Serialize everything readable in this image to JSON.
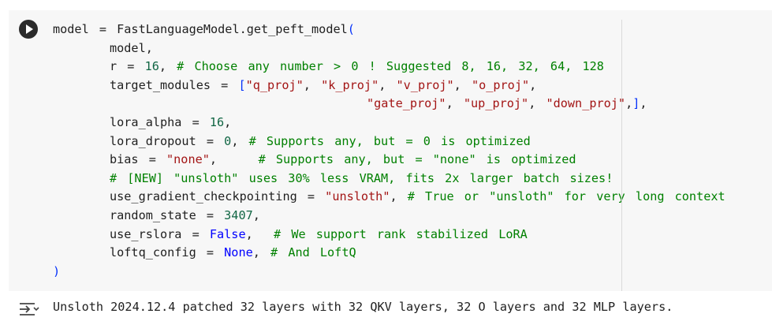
{
  "cell": {
    "lines": [
      {
        "parts": [
          [
            "kw",
            "model = FastLanguageModel.get_peft_model"
          ],
          [
            "brk",
            "("
          ]
        ]
      },
      {
        "indent": 1,
        "parts": [
          [
            "kw",
            "model,"
          ]
        ]
      },
      {
        "indent": 1,
        "parts": [
          [
            "kw",
            "r = "
          ],
          [
            "num",
            "16"
          ],
          [
            "kw",
            ", "
          ],
          [
            "cmt",
            "# Choose any number > 0 ! Suggested 8, 16, 32, 64, 128"
          ]
        ]
      },
      {
        "indent": 1,
        "parts": [
          [
            "kw",
            "target_modules = "
          ],
          [
            "brk",
            "["
          ],
          [
            "str",
            "\"q_proj\""
          ],
          [
            "kw",
            ", "
          ],
          [
            "str",
            "\"k_proj\""
          ],
          [
            "kw",
            ", "
          ],
          [
            "str",
            "\"v_proj\""
          ],
          [
            "kw",
            ", "
          ],
          [
            "str",
            "\"o_proj\""
          ],
          [
            "kw",
            ","
          ]
        ]
      },
      {
        "indent": 2,
        "parts": [
          [
            "str",
            "\"gate_proj\""
          ],
          [
            "kw",
            ", "
          ],
          [
            "str",
            "\"up_proj\""
          ],
          [
            "kw",
            ", "
          ],
          [
            "str",
            "\"down_proj\""
          ],
          [
            "kw",
            ","
          ],
          [
            "brk",
            "]"
          ],
          [
            "kw",
            ","
          ]
        ]
      },
      {
        "indent": 1,
        "parts": [
          [
            "kw",
            "lora_alpha = "
          ],
          [
            "num",
            "16"
          ],
          [
            "kw",
            ","
          ]
        ]
      },
      {
        "indent": 1,
        "parts": [
          [
            "kw",
            "lora_dropout = "
          ],
          [
            "num",
            "0"
          ],
          [
            "kw",
            ", "
          ],
          [
            "cmt",
            "# Supports any, but = 0 is optimized"
          ]
        ]
      },
      {
        "indent": 1,
        "parts": [
          [
            "kw",
            "bias = "
          ],
          [
            "str",
            "\"none\""
          ],
          [
            "kw",
            ",    "
          ],
          [
            "cmt",
            "# Supports any, but = \"none\" is optimized"
          ]
        ]
      },
      {
        "indent": 1,
        "parts": [
          [
            "cmt",
            "# [NEW] \"unsloth\" uses 30% less VRAM, fits 2x larger batch sizes!"
          ]
        ]
      },
      {
        "indent": 1,
        "parts": [
          [
            "kw",
            "use_gradient_checkpointing = "
          ],
          [
            "str",
            "\"unsloth\""
          ],
          [
            "kw",
            ", "
          ],
          [
            "cmt",
            "# True or \"unsloth\" for very long context"
          ]
        ]
      },
      {
        "indent": 1,
        "parts": [
          [
            "kw",
            "random_state = "
          ],
          [
            "num",
            "3407"
          ],
          [
            "kw",
            ","
          ]
        ]
      },
      {
        "indent": 1,
        "parts": [
          [
            "kw",
            "use_rslora = "
          ],
          [
            "const",
            "False"
          ],
          [
            "kw",
            ",  "
          ],
          [
            "cmt",
            "# We support rank stabilized LoRA"
          ]
        ]
      },
      {
        "indent": 1,
        "parts": [
          [
            "kw",
            "loftq_config = "
          ],
          [
            "const",
            "None"
          ],
          [
            "kw",
            ", "
          ],
          [
            "cmt",
            "# And LoftQ"
          ]
        ]
      },
      {
        "parts": [
          [
            "brk",
            ")"
          ]
        ]
      }
    ]
  },
  "output": {
    "icon": "output-toggle-icon",
    "text": "Unsloth 2024.12.4 patched 32 layers with 32 QKV layers, 32 O layers and 32 MLP layers."
  },
  "colors": {
    "string": "#a31515",
    "number": "#116644",
    "comment": "#008000",
    "constant": "#0000ff",
    "bracket": "#0431fa"
  }
}
